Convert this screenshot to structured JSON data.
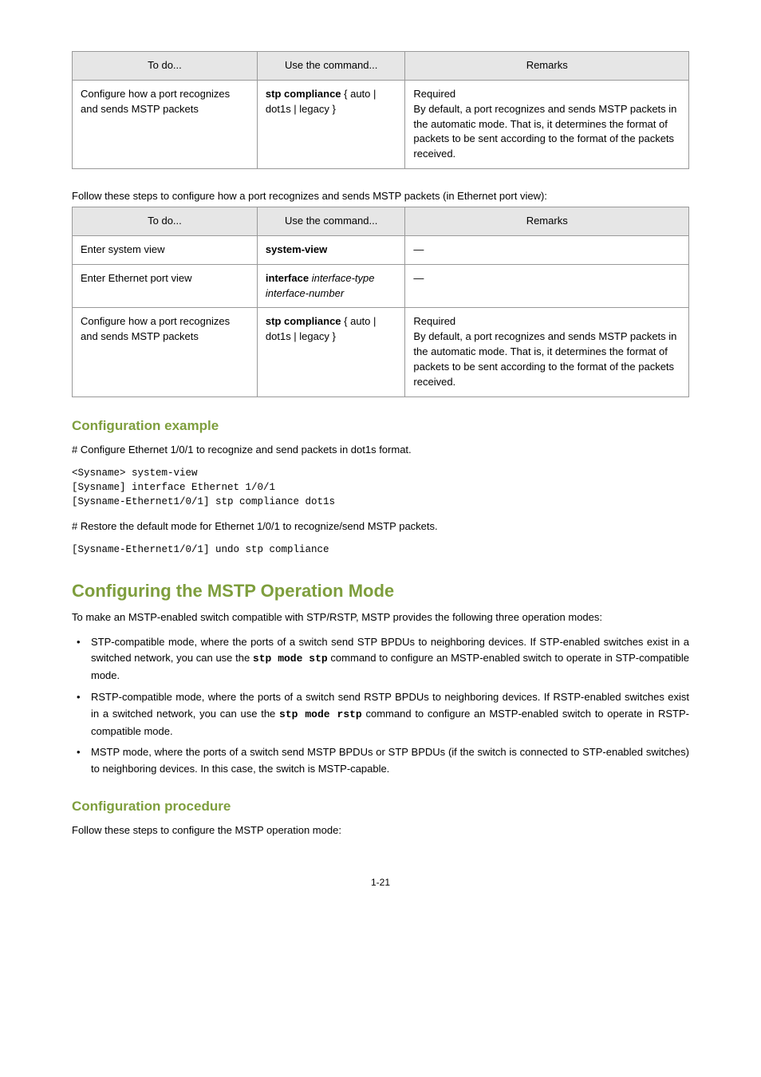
{
  "table1": {
    "header": [
      "To do...",
      "Use the command...",
      "Remarks"
    ],
    "row": {
      "todo": "Configure how a port recognizes and sends MSTP packets",
      "cmd_prefix": "stp compliance ",
      "cmd_options": "{ auto | dot1s | legacy }",
      "remarks_line1": "Required",
      "remarks_rest": "By default, a port recognizes and sends MSTP packets in the automatic mode. That is, it determines the format of packets to be sent according to the format of the packets received."
    }
  },
  "intro2": "Follow these steps to configure how a port recognizes and sends MSTP packets (in Ethernet port view):",
  "table2": {
    "header": [
      "To do...",
      "Use the command...",
      "Remarks"
    ],
    "rows": [
      {
        "todo": "Enter system view",
        "cmd": "system-view",
        "remarks": "—"
      },
      {
        "todo": "Enter Ethernet port view",
        "cmd_prefix": "interface ",
        "cmd_args": "interface-type interface-number",
        "remarks": "—"
      }
    ],
    "row3": {
      "todo": "Configure how a port recognizes and sends MSTP packets",
      "cmd_prefix": "stp compliance ",
      "cmd_options": "{ auto | dot1s | legacy }",
      "remarks_line1": "Required",
      "remarks_rest": "By default, a port recognizes and sends MSTP packets in the automatic mode. That is, it determines the format of packets to be sent according to the format of the packets received."
    }
  },
  "example": {
    "heading": "Configuration example",
    "p1": "# Configure Ethernet 1/0/1 to recognize and send packets in dot1s format.",
    "cmd1": "<Sysname> system-view\n[Sysname] interface Ethernet 1/0/1\n[Sysname-Ethernet1/0/1] stp compliance dot1s",
    "p2": "# Restore the default mode for Ethernet 1/0/1 to recognize/send MSTP packets.",
    "cmd2": "[Sysname-Ethernet1/0/1] undo stp compliance"
  },
  "section": {
    "heading": "Configuring the MSTP Operation Mode",
    "intro": "To make an MSTP-enabled switch compatible with STP/RSTP, MSTP provides the following three operation modes:",
    "bullets": [
      {
        "pre": "STP-compatible mode, where the ports of a switch send STP BPDUs to neighboring devices. If STP-enabled switches exist in a switched network, you can use the ",
        "cmd": "stp mode stp",
        "post": " command to configure an MSTP-enabled switch to operate in STP-compatible mode."
      },
      {
        "pre": "RSTP-compatible mode, where the ports of a switch send RSTP BPDUs to neighboring devices. If RSTP-enabled switches exist in a switched network, you can use the ",
        "cmd": "stp mode rstp",
        "post": " command to configure an MSTP-enabled switch to operate in RSTP-compatible mode."
      },
      {
        "pre": "MSTP mode, where the ports of a switch send MSTP BPDUs or STP BPDUs (if the switch is connected to STP-enabled switches) to neighboring devices. In this case, the switch is MSTP-capable.",
        "cmd": "",
        "post": ""
      }
    ],
    "sub": "Configuration procedure",
    "sub_intro": "Follow these steps to configure the MSTP operation mode:"
  },
  "pagenum": "1-21"
}
